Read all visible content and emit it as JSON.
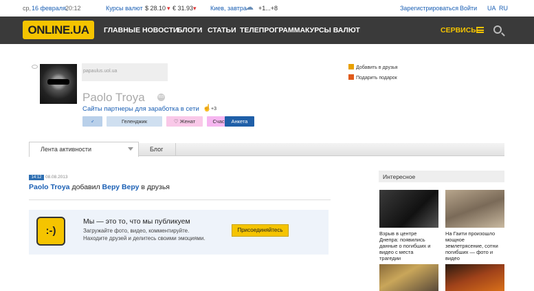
{
  "topbar": {
    "date_prefix": "ср,",
    "date": "16 февраля,",
    "time": "20:12",
    "currency_label": "Курсы валют",
    "usd": "$ 28.10",
    "usd_arrow": "▾",
    "eur": "€ 31.93",
    "eur_arrow": "▾",
    "weather_label": "Киев, завтра",
    "weather_icon": "cloud-snow-icon",
    "weather_temp": "+1...+8",
    "register": "Зарегистрироваться",
    "login": "Войти",
    "lang_ua": "UA",
    "lang_ru": "RU"
  },
  "nav": {
    "logo": "ONLINE.UA",
    "items": [
      "ГЛАВНЫЕ НОВОСТИ",
      "БЛОГИ",
      "СТАТЬИ",
      "ТЕЛЕПРОГРАММА",
      "КУРСЫ ВАЛЮТ"
    ],
    "services": "СЕРВИСЫ"
  },
  "profile": {
    "url": "papaulus.uol.ua",
    "name": "Paolo Troya",
    "badge": "815",
    "link": "Сайты партнеры для заработка в сети",
    "like_count": "+3",
    "tags": [
      "♂",
      "Геленджик",
      "♡ Женат",
      "Счастлив",
      "Анкета"
    ],
    "actions": [
      "Добавить в друзья",
      "Подарить подарок"
    ]
  },
  "tabs": {
    "activity": "Лента активности",
    "blog": "Блог"
  },
  "feed": {
    "time": "14:12",
    "date": "08.08.2013",
    "actor": "Paolo Troya",
    "verb": " добавил ",
    "target": "Веру Веру",
    "suffix": " в друзья"
  },
  "promo": {
    "smiley": ":-)",
    "title": "Мы — это то, что мы публикуем",
    "line1": "Загружайте фото, видео, комментируйте.",
    "line2": "Находите друзей и делитесь своими эмоциями.",
    "button": "Присоединяйтесь"
  },
  "sidebar": {
    "title": "Интересное",
    "items": [
      {
        "caption": [
          "Взрыв в центре",
          "Днепра: появились",
          "данные о погибших и",
          "видео с места",
          "трагедии"
        ]
      },
      {
        "caption": [
          "На Гаити произошло",
          "мощное",
          "землетрясение, сотни",
          "погибших — фото и",
          "видео"
        ]
      }
    ]
  },
  "colors": {
    "accent": "#f5c400",
    "nav_bg": "#3a3a3a",
    "link": "#1a5fb4"
  }
}
